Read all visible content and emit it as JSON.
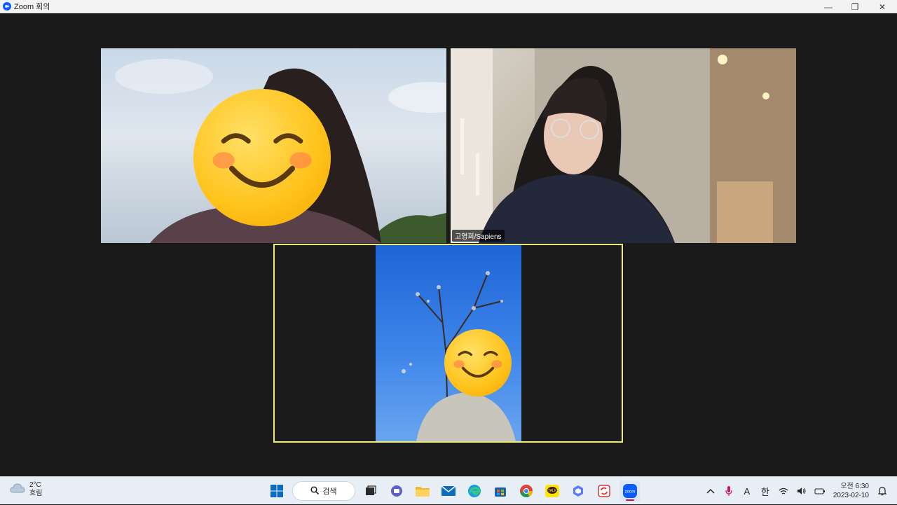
{
  "window": {
    "title": "Zoom 회의",
    "minimize_glyph": "—",
    "restore_glyph": "❐",
    "close_glyph": "✕"
  },
  "participants": [
    {
      "name": "",
      "position": "top-left"
    },
    {
      "name": "고영희/Sapiens",
      "position": "top-right"
    },
    {
      "name": "",
      "position": "bottom-center",
      "active_speaker": true
    }
  ],
  "taskbar": {
    "weather": {
      "temp": "2°C",
      "condition": "흐림"
    },
    "search_label": "검색",
    "apps": [
      "task-view-icon",
      "teams-chat-icon",
      "file-explorer-icon",
      "mail-icon",
      "edge-icon",
      "store-icon",
      "chrome-icon",
      "kakaotalk-icon",
      "copilot-icon",
      "sync-app-icon",
      "zoom-icon"
    ],
    "kakaotalk_label": "TALK",
    "zoom_label": "zoom",
    "ime_letter": "A",
    "ime_hangul": "한",
    "clock": {
      "time": "오전 6:30",
      "date": "2023-02-10"
    }
  },
  "colors": {
    "active_speaker_border": "#e9ec7a",
    "taskbar_bg": "#e8eef6",
    "zoom_blue": "#0b5cff"
  }
}
